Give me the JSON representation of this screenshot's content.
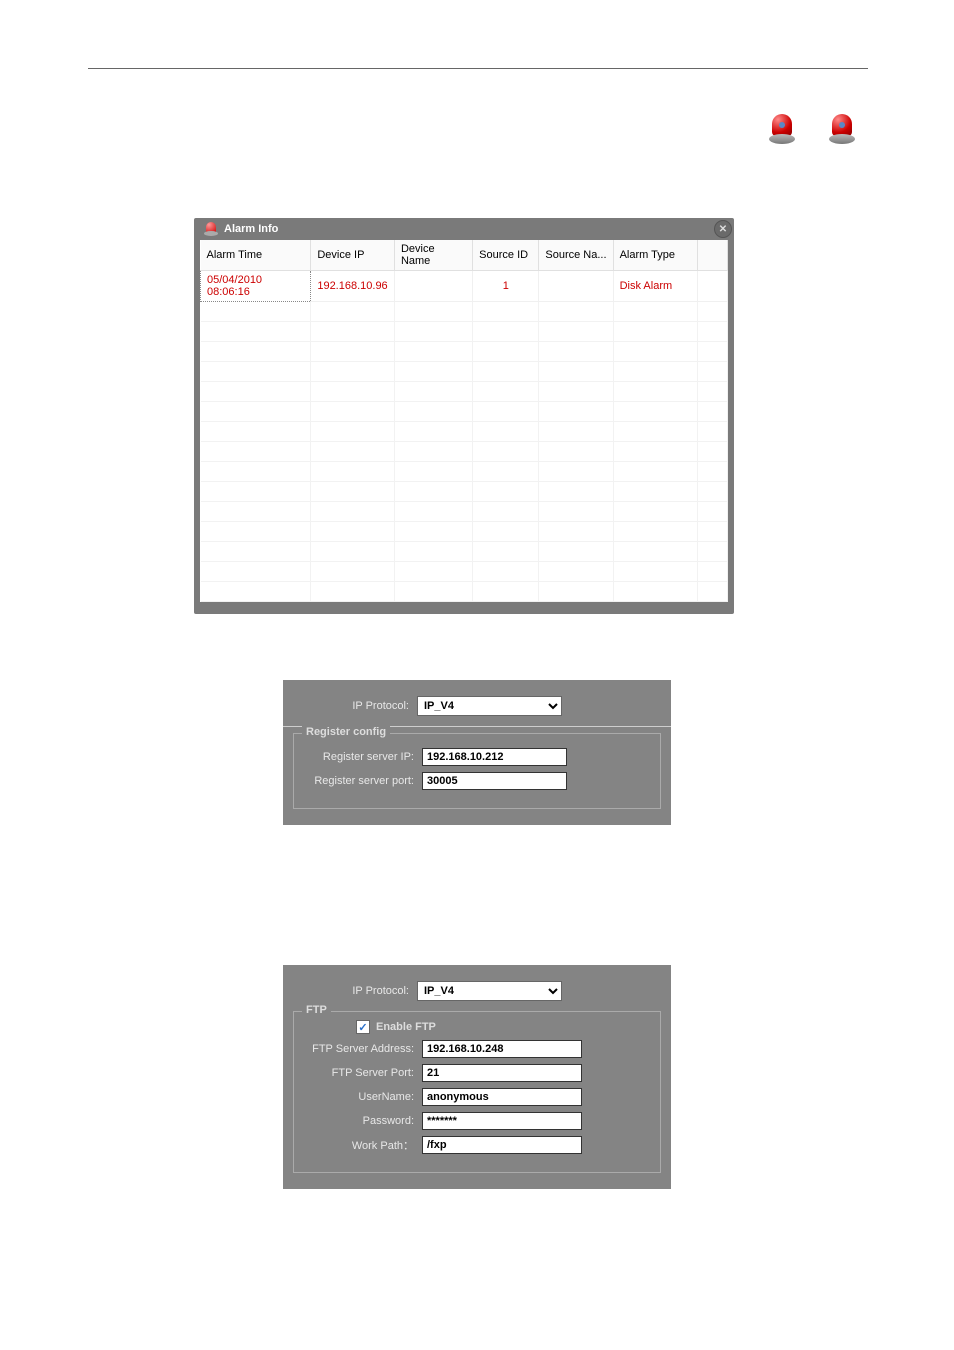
{
  "alarm_window": {
    "title": "Alarm Info",
    "columns": [
      "Alarm Time",
      "Device IP",
      "Device Name",
      "Source ID",
      "Source Na...",
      "Alarm Type"
    ],
    "rows": [
      {
        "time": "05/04/2010 08:06:16",
        "ip": "192.168.10.96",
        "name": "",
        "source_id": "1",
        "source_na": "",
        "type": "Disk Alarm"
      }
    ],
    "empty_row_count": 15
  },
  "register_panel": {
    "ip_protocol_label": "IP Protocol:",
    "ip_protocol_value": "IP_V4",
    "fieldset_title": "Register config",
    "server_ip_label": "Register server IP:",
    "server_ip_value": "192.168.10.212",
    "server_port_label": "Register server port:",
    "server_port_value": "30005"
  },
  "ftp_panel": {
    "ip_protocol_label": "IP Protocol:",
    "ip_protocol_value": "IP_V4",
    "fieldset_title": "FTP",
    "enable_label": "Enable FTP",
    "enable_checked": true,
    "addr_label": "FTP Server Address:",
    "addr_value": "192.168.10.248",
    "port_label": "FTP Server Port:",
    "port_value": "21",
    "user_label": "UserName:",
    "user_value": "anonymous",
    "pass_label": "Password:",
    "pass_value": "*******",
    "path_label": "Work Path：",
    "path_value": "/fxp"
  }
}
